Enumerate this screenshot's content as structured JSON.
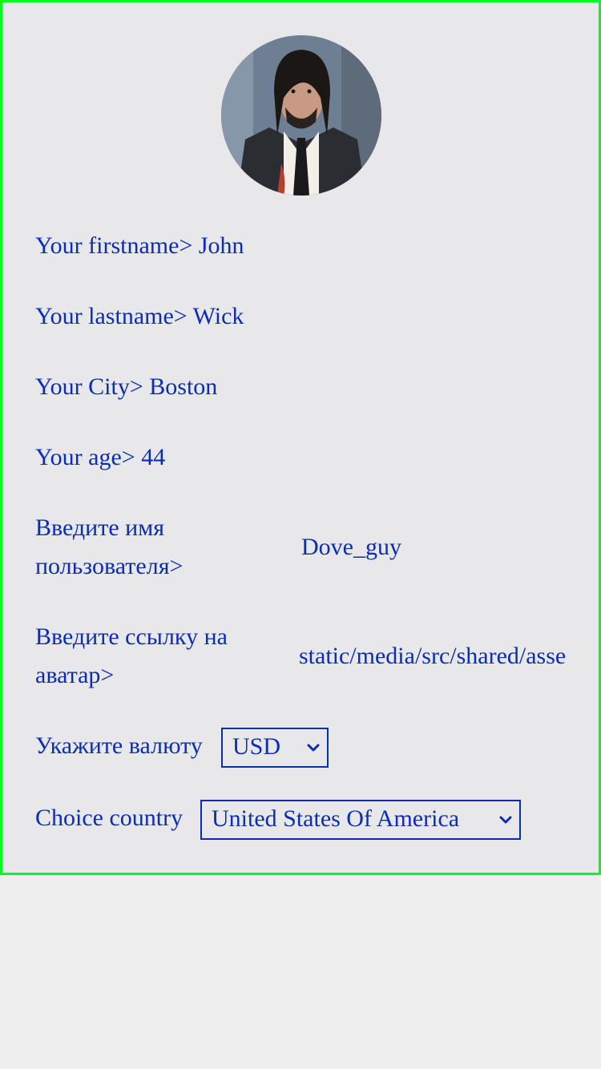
{
  "profile": {
    "firstname_label": "Your firstname>",
    "firstname_value": "John",
    "lastname_label": "Your lastname>",
    "lastname_value": "Wick",
    "city_label": "Your City>",
    "city_value": "Boston",
    "age_label": "Your age>",
    "age_value": "44",
    "username_label": "Введите имя пользователя>",
    "username_value": "Dove_guy",
    "avatar_link_label": "Введите ссылку на аватар>",
    "avatar_link_value": "static/media/src/shared/assets",
    "currency_label": "Укажите валюту",
    "currency_value": "USD",
    "country_label": "Choice country",
    "country_value": "United States Of America"
  },
  "colors": {
    "accent": "#0b2db3",
    "frame_border": "#00ff1a",
    "background": "#e8e7ea"
  },
  "icons": {
    "avatar": "profile-photo",
    "dropdown": "chevron-down-icon"
  }
}
